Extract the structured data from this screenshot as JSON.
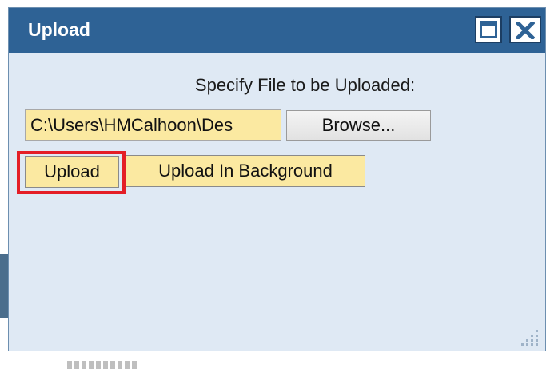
{
  "dialog": {
    "title": "Upload",
    "maximize_icon": "maximize-icon",
    "close_icon": "close-icon"
  },
  "form": {
    "instruction": "Specify File to be Uploaded:",
    "file_path_value": "C:\\Users\\HMCalhoon\\Des",
    "browse_label": "Browse...",
    "upload_label": "Upload",
    "upload_background_label": "Upload In Background"
  },
  "colors": {
    "titlebar": "#2e6295",
    "dialog_body": "#dfe9f4",
    "input_highlight": "#fbe9a1",
    "annotation_box": "#e41e26"
  },
  "annotation": {
    "highlighted_element": "upload-button"
  }
}
